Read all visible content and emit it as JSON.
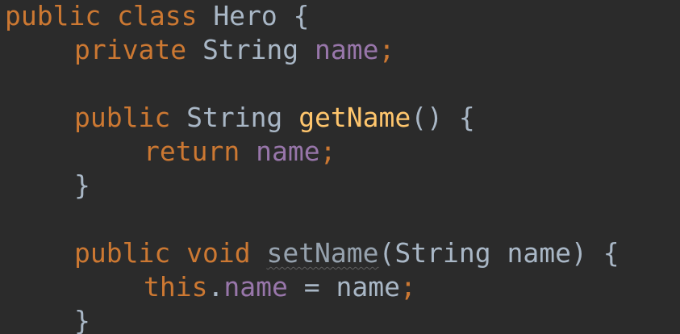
{
  "code": {
    "line1": {
      "kw_public": "public",
      "kw_class": "class",
      "class_name": "Hero",
      "brace_open": "{"
    },
    "line2": {
      "kw_private": "private",
      "type": "String",
      "field": "name",
      "semicolon": ";"
    },
    "line4": {
      "kw_public": "public",
      "type": "String",
      "method": "getName",
      "parens": "()",
      "brace_open": "{"
    },
    "line5": {
      "kw_return": "return",
      "field": "name",
      "semicolon": ";"
    },
    "line6": {
      "brace_close": "}"
    },
    "line8": {
      "kw_public": "public",
      "kw_void": "void",
      "method": "setName",
      "paren_open": "(",
      "param_type": "String",
      "param_name": "name",
      "paren_close": ")",
      "brace_open": "{"
    },
    "line9": {
      "kw_this": "this",
      "dot": ".",
      "field": "name",
      "assign": "=",
      "param_name": "name",
      "semicolon": ";"
    },
    "line10": {
      "brace_close": "}"
    }
  },
  "colors": {
    "background": "#2b2b2b",
    "keyword": "#cc7832",
    "field": "#9876aa",
    "method": "#ffc66d",
    "plain": "#a9b7c6"
  }
}
